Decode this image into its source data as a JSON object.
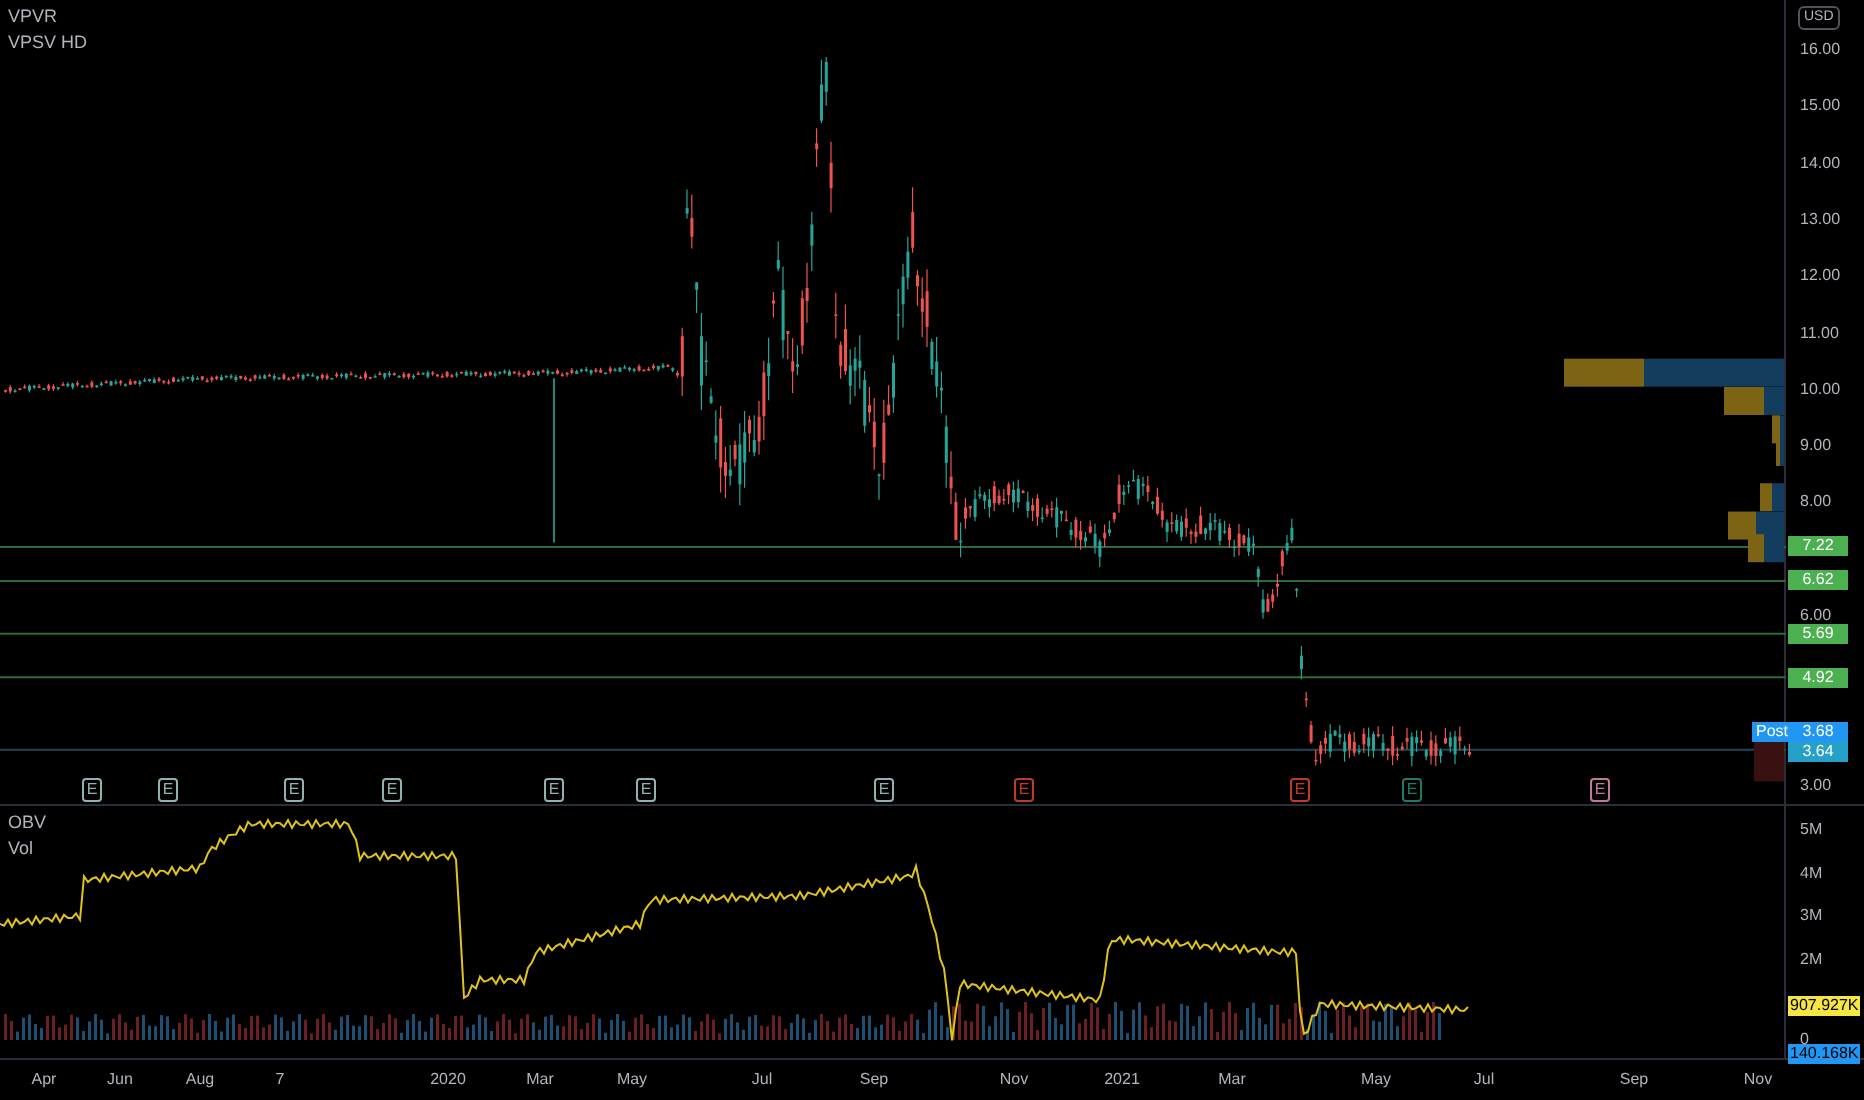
{
  "legend": {
    "symbol": "VPVR",
    "indicator": "VPSV HD"
  },
  "currency": "USD",
  "price_ticks": [
    "16.00",
    "15.00",
    "14.00",
    "13.00",
    "12.00",
    "11.00",
    "10.00",
    "9.00",
    "8.00",
    "6.00",
    "3.00"
  ],
  "price_labels": [
    {
      "text": "7.22",
      "kind": "level"
    },
    {
      "text": "6.62",
      "kind": "level"
    },
    {
      "text": "5.69",
      "kind": "level"
    },
    {
      "text": "4.92",
      "kind": "level"
    },
    {
      "text": "3.68",
      "kind": "last",
      "badge": "Post"
    },
    {
      "text": "3.64",
      "kind": "close"
    }
  ],
  "earnings": [
    {
      "label": "E",
      "color": "#8fb3b0"
    },
    {
      "label": "E",
      "color": "#8fb3b0"
    },
    {
      "label": "E",
      "color": "#8fb3b0"
    },
    {
      "label": "E",
      "color": "#8fb3b0"
    },
    {
      "label": "E",
      "color": "#8fb3b0"
    },
    {
      "label": "E",
      "color": "#8fb3b0"
    },
    {
      "label": "E",
      "color": "#8fb3b0"
    },
    {
      "label": "E",
      "color": "#c0392b"
    },
    {
      "label": "E",
      "color": "#c0392b"
    },
    {
      "label": "E",
      "color": "#1e7a6a"
    },
    {
      "label": "E",
      "color": "#c07a9a"
    }
  ],
  "lower_pane": {
    "legend": [
      "OBV",
      "Vol"
    ],
    "ticks": [
      "5M",
      "4M",
      "3M",
      "2M",
      "0"
    ],
    "labels": [
      {
        "text": "907.927K",
        "color": "#f5e642"
      },
      {
        "text": "140.168K",
        "color": "#2196f3"
      }
    ]
  },
  "time_axis": [
    "Apr",
    "Jun",
    "Aug",
    "7",
    "2020",
    "Mar",
    "May",
    "Jul",
    "Sep",
    "Nov",
    "2021",
    "Mar",
    "May",
    "Jul",
    "Sep",
    "Nov"
  ]
}
